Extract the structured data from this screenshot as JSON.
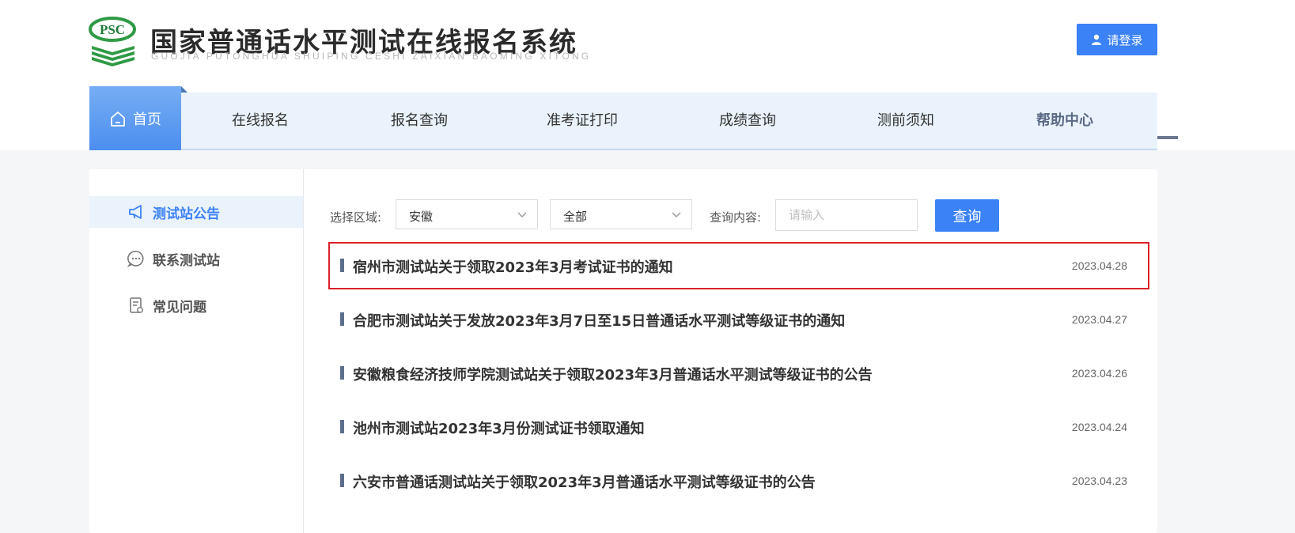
{
  "header": {
    "logo_text": "PSC",
    "title": "国家普通话水平测试在线报名系统",
    "subtitle": "GUOJIA PUTONGHUA SHUIPING CESHI ZAIXIAN BAOMING XITONG",
    "login_label": "请登录"
  },
  "nav": {
    "home_label": "首页",
    "items": [
      {
        "label": "在线报名"
      },
      {
        "label": "报名查询"
      },
      {
        "label": "准考证打印"
      },
      {
        "label": "成绩查询"
      },
      {
        "label": "测前须知"
      },
      {
        "label": "帮助中心",
        "active": true
      }
    ]
  },
  "sidebar": {
    "items": [
      {
        "label": "测试站公告",
        "icon": "megaphone-icon",
        "active": true
      },
      {
        "label": "联系测试站",
        "icon": "chat-icon"
      },
      {
        "label": "常见问题",
        "icon": "document-icon"
      }
    ]
  },
  "filter": {
    "region_label": "选择区域:",
    "region_value": "安徽",
    "scope_value": "全部",
    "query_label": "查询内容:",
    "query_placeholder": "请输入",
    "query_button": "查询"
  },
  "notices": [
    {
      "title": "宿州市测试站关于领取2023年3月考试证书的通知",
      "date": "2023.04.28",
      "highlighted": true
    },
    {
      "title": "合肥市测试站关于发放2023年3月7日至15日普通话水平测试等级证书的通知",
      "date": "2023.04.27"
    },
    {
      "title": "安徽粮食经济技师学院测试站关于领取2023年3月普通话水平测试等级证书的公告",
      "date": "2023.04.26"
    },
    {
      "title": "池州市测试站2023年3月份测试证书领取通知",
      "date": "2023.04.24"
    },
    {
      "title": "六安市普通话测试站关于领取2023年3月普通话水平测试等级证书的公告",
      "date": "2023.04.23"
    }
  ],
  "colors": {
    "accent": "#3b82f6",
    "nav_bg": "#eaf2fc",
    "highlight_border": "#d9222a"
  }
}
